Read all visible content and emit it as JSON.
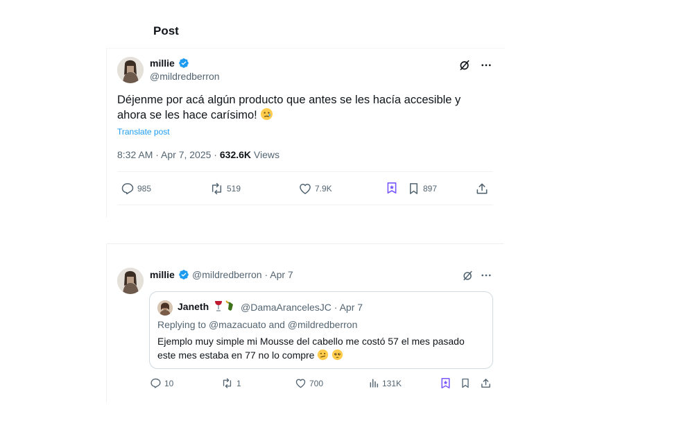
{
  "page": {
    "title": "Post"
  },
  "post": {
    "author": {
      "name": "millie",
      "handle": "@mildredberron"
    },
    "text": "Déjenme por acá algún producto que antes se les hacía accesible y ahora se les hace carísimo!",
    "translate_label": "Translate post",
    "time": "8:32 AM · Apr 7, 2025 ·",
    "views_count": "632.6K",
    "views_label": "Views",
    "actions": {
      "replies": "985",
      "reposts": "519",
      "likes": "7.9K",
      "bookmarks": "897"
    }
  },
  "reply": {
    "author": {
      "name": "millie",
      "handle_date": "@mildredberron · Apr 7"
    },
    "quote": {
      "name": "Janeth",
      "handle_date": "@DamaArancelesJC · Apr 7",
      "replying_prefix": "Replying to",
      "replying_to_1": "@mazacuato",
      "replying_and": "and",
      "replying_to_2": "@mildredberron",
      "text": "Ejemplo muy simple mi Mousse del cabello me costó 57 el mes pasado este mes estaba en 77 no lo compre"
    },
    "actions": {
      "replies": "10",
      "reposts": "1",
      "likes": "700",
      "views": "131K"
    }
  },
  "icons": {
    "verified": "verified-badge-icon",
    "grok": "grok-icon",
    "more": "more-icon",
    "reply": "reply-icon",
    "repost": "repost-icon",
    "like": "heart-icon",
    "analytics": "analytics-icon",
    "bookmark": "bookmark-icon",
    "share": "share-icon"
  },
  "colors": {
    "accent": "#1d9bf0",
    "bookmark_accent": "#7856ff",
    "muted": "#536471",
    "text": "#0f1419"
  }
}
